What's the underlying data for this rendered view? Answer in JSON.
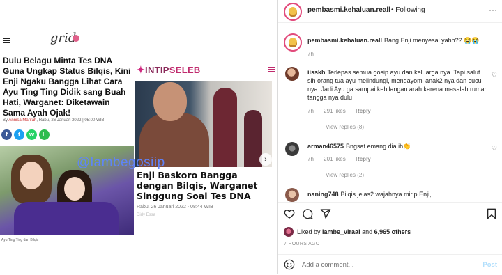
{
  "post_image": {
    "grid_article": {
      "logo": "grid",
      "title": "Dulu Belagu Minta Tes DNA Guna Ungkap Status Bilqis, Kini Enji Ngaku Bangga Lihat Cara Ayu Ting Ting Didik sang Buah Hati, Warganet: Diketawain Sama Ayah Ojak!",
      "byline_prefix": "By",
      "author": "Annisa Marifah",
      "date": ", Rabu, 26 Januari 2022 | 05:00 WIB",
      "photo_caption": "Ayu Ting Ting dan Bilqis",
      "share_icons": [
        "facebook-icon",
        "twitter-icon",
        "whatsapp-icon",
        "line-icon"
      ]
    },
    "watermark": "@lambegosiip",
    "intip_article": {
      "logo_a": "INTIP",
      "logo_b": "SELEB",
      "title": "Enji Baskoro Bangga dengan Bilqis, Warganet Singgung Soal Tes DNA",
      "date": "Rabu, 26 Januari 2022 - 08:44 WIB",
      "author": "Dirly Essa"
    }
  },
  "header": {
    "username": "pembasmi.kehaluan.reall",
    "separator": "•",
    "follow_status": "Following",
    "more": "···"
  },
  "caption": {
    "username": "pembasmi.kehaluan.reall",
    "text": "Bang Enji menyesal yahh?? 😭😭",
    "time": "7h"
  },
  "comments": [
    {
      "username": "iisskh",
      "text": "Terlepas semua gosip ayu dan keluarga nya. Tapi salut sih orang tua ayu melindungi, mengayomi anak2 nya dan cucu nya. Jadi Ayu ga sampai kehilangan arah karena masalah rumah tangga nya dulu",
      "time": "7h",
      "likes": "291 likes",
      "reply": "Reply",
      "view_replies": "View replies (8)"
    },
    {
      "username": "arman46575",
      "text": "Bngsat emang dia ih👏",
      "time": "7h",
      "likes": "201 likes",
      "reply": "Reply",
      "view_replies": "View replies (2)"
    },
    {
      "username": "naning748",
      "text": "Bilqis jelas2 wajahnya mirip Enji,"
    }
  ],
  "footer": {
    "liked_by_prefix": "Liked by ",
    "liked_by_user": "lambe_viraal",
    "liked_by_and": " and ",
    "liked_by_count": "6,965 others",
    "timestamp": "7 HOURS AGO",
    "comment_placeholder": "Add a comment...",
    "post_label": "Post"
  },
  "colors": {
    "link_blue": "#b2dffc",
    "watermark_blue": "#5e84ff",
    "story_ring": "#e24a7b"
  }
}
